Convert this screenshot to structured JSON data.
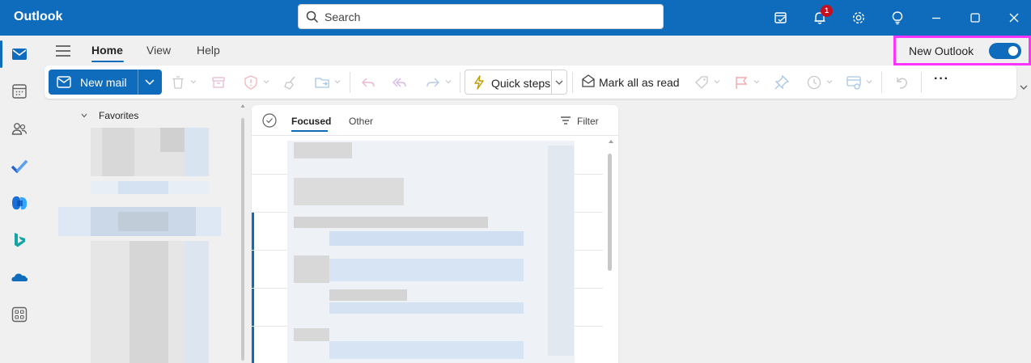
{
  "titlebar": {
    "app_title": "Outlook",
    "search_placeholder": "Search",
    "notification_count": "1",
    "icons": [
      "my-day-icon",
      "bell-icon",
      "gear-icon",
      "lightbulb-icon",
      "minimize-icon",
      "maximize-icon",
      "close-icon"
    ]
  },
  "rail": {
    "items": [
      "mail-icon",
      "calendar-icon",
      "people-icon",
      "todo-icon",
      "office-icon",
      "bing-icon",
      "onedrive-icon",
      "more-apps-icon"
    ],
    "active": "mail-icon"
  },
  "menu": {
    "tabs": [
      "Home",
      "View",
      "Help"
    ],
    "active_tab": "Home",
    "new_outlook_label": "New Outlook",
    "new_outlook_on": true
  },
  "ribbon": {
    "new_mail_label": "New mail",
    "quick_steps_label": "Quick steps",
    "mark_all_read_label": "Mark all as read",
    "more_label": "···"
  },
  "folders": {
    "favorites_label": "Favorites"
  },
  "maillist": {
    "tabs": [
      "Focused",
      "Other"
    ],
    "active_tab": "Focused",
    "filter_label": "Filter"
  },
  "colors": {
    "accent": "#0f6cbd",
    "highlight_box": "#ff33ff",
    "badge": "#c50f1f"
  }
}
